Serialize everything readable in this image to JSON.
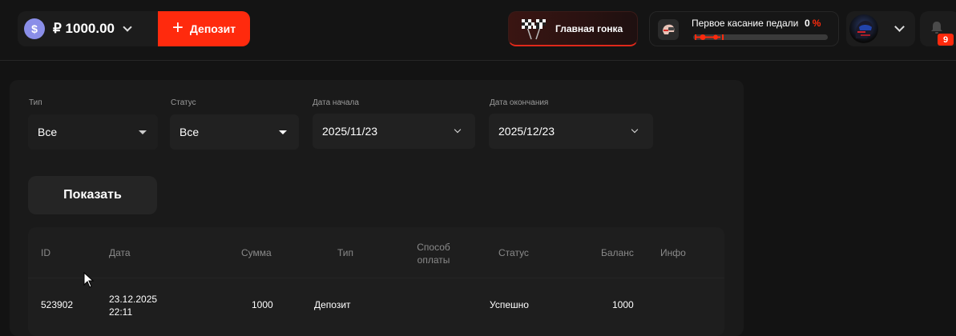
{
  "header": {
    "balance": "₽ 1000.00",
    "coin_symbol": "$",
    "deposit_label": "Депозит",
    "race_label": "Главная гонка",
    "quest": {
      "title": "Первое касание педали",
      "percent_value": "0",
      "percent_sign": "%",
      "progress": 0
    },
    "notifications_count": "9"
  },
  "filters": {
    "type": {
      "label": "Тип",
      "value": "Все"
    },
    "status": {
      "label": "Статус",
      "value": "Все"
    },
    "date_start": {
      "label": "Дата начала",
      "value": "2025/11/23"
    },
    "date_end": {
      "label": "Дата окончания",
      "value": "2025/12/23"
    }
  },
  "show_button": "Показать",
  "table": {
    "headers": {
      "id": "ID",
      "date": "Дата",
      "amount": "Сумма",
      "type": "Тип",
      "method_line1": "Способ",
      "method_line2": "оплаты",
      "status": "Статус",
      "balance": "Баланс",
      "info": "Инфо"
    },
    "rows": [
      {
        "id": "523902",
        "date": "23.12.2025",
        "time": "22:11",
        "amount": "1000",
        "type": "Депозит",
        "method": "",
        "status": "Успешно",
        "balance": "1000",
        "info": ""
      }
    ]
  },
  "colors": {
    "accent": "#ff2a0d",
    "background": "#131313",
    "panel": "#1a1a1a"
  }
}
